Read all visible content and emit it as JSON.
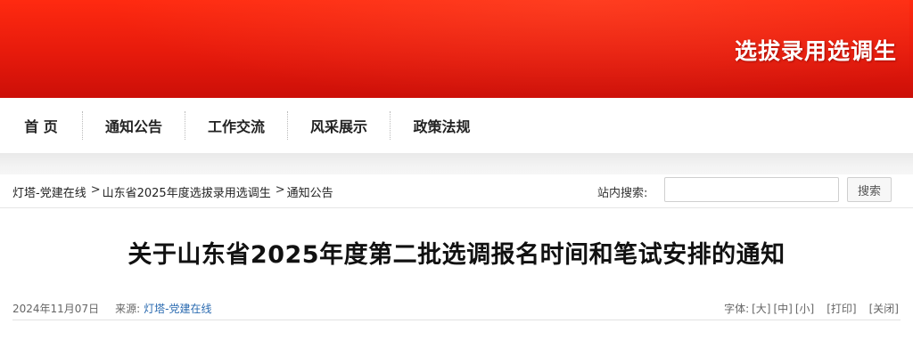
{
  "banner": {
    "title": "选拔录用选调生"
  },
  "nav": {
    "items": [
      {
        "label": "首 页"
      },
      {
        "label": "通知公告"
      },
      {
        "label": "工作交流"
      },
      {
        "label": "风采展示"
      },
      {
        "label": "政策法规"
      }
    ]
  },
  "breadcrumb": {
    "items": [
      "灯塔-党建在线",
      "山东省2025年度选拔录用选调生",
      "通知公告"
    ],
    "separator": ">"
  },
  "search": {
    "label": "站内搜索:",
    "value": "",
    "placeholder": "",
    "button_label": "搜索"
  },
  "article": {
    "title": "关于山东省2025年度第二批选调报名时间和笔试安排的通知",
    "date": "2024年11月07日",
    "source_label": "来源:",
    "source_name": "灯塔-党建在线",
    "font_label": "字体:",
    "font_large": "[大]",
    "font_medium": "[中]",
    "font_small": "[小]",
    "print_label": "[打印]",
    "close_label": "[关闭]"
  }
}
